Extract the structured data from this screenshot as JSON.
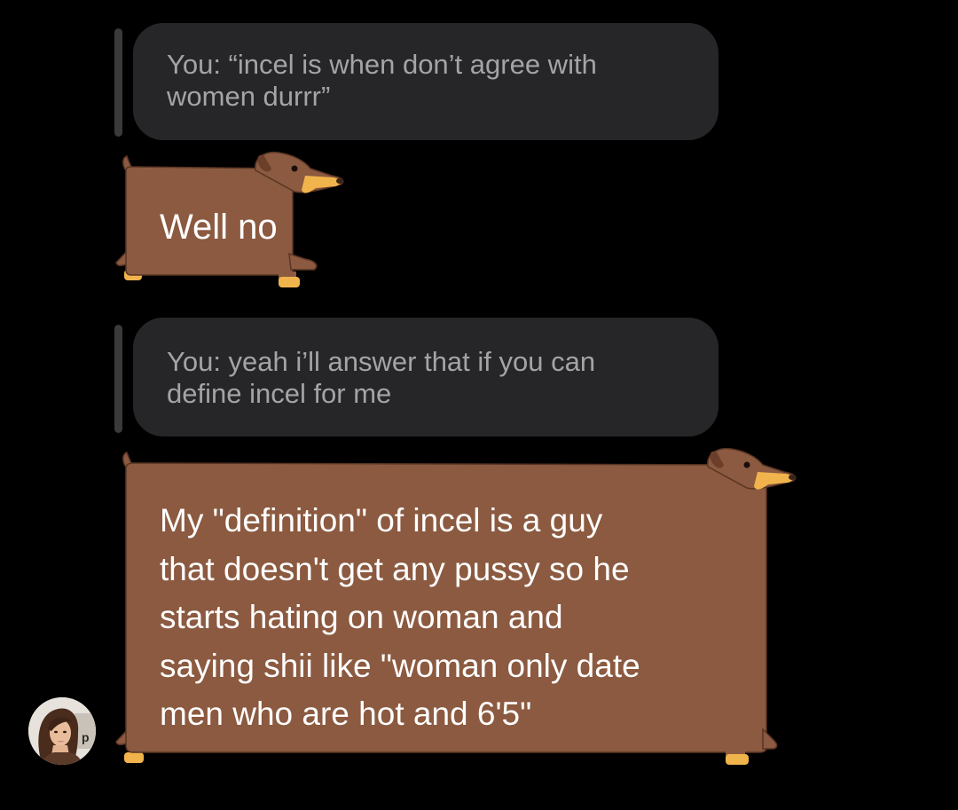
{
  "colors": {
    "background": "#000000",
    "quote_bubble": "#262628",
    "quote_text": "#a3a3a8",
    "reply_bar": "#3a3a3c",
    "dog_body": "#8b5a40",
    "dog_outline": "#5a3524",
    "dog_snout": "#f1b44c",
    "message_text": "#ffffff"
  },
  "messages": [
    {
      "kind": "reply_quote",
      "text": "You: “incel is when don’t agree with\nwomen durrr”"
    },
    {
      "kind": "sticker_message",
      "text": "Well no"
    },
    {
      "kind": "reply_quote",
      "text": "You: yeah i’ll answer that if you can\ndefine incel for me"
    },
    {
      "kind": "sticker_message",
      "text": "My \"definition\" of incel is a guy\nthat doesn't get any pussy so he\nstarts hating on woman and\nsaying shii like \"woman only date\nmen who are hot and 6'5\""
    }
  ],
  "sender": {
    "avatar_icon": "woman-portrait-avatar"
  }
}
